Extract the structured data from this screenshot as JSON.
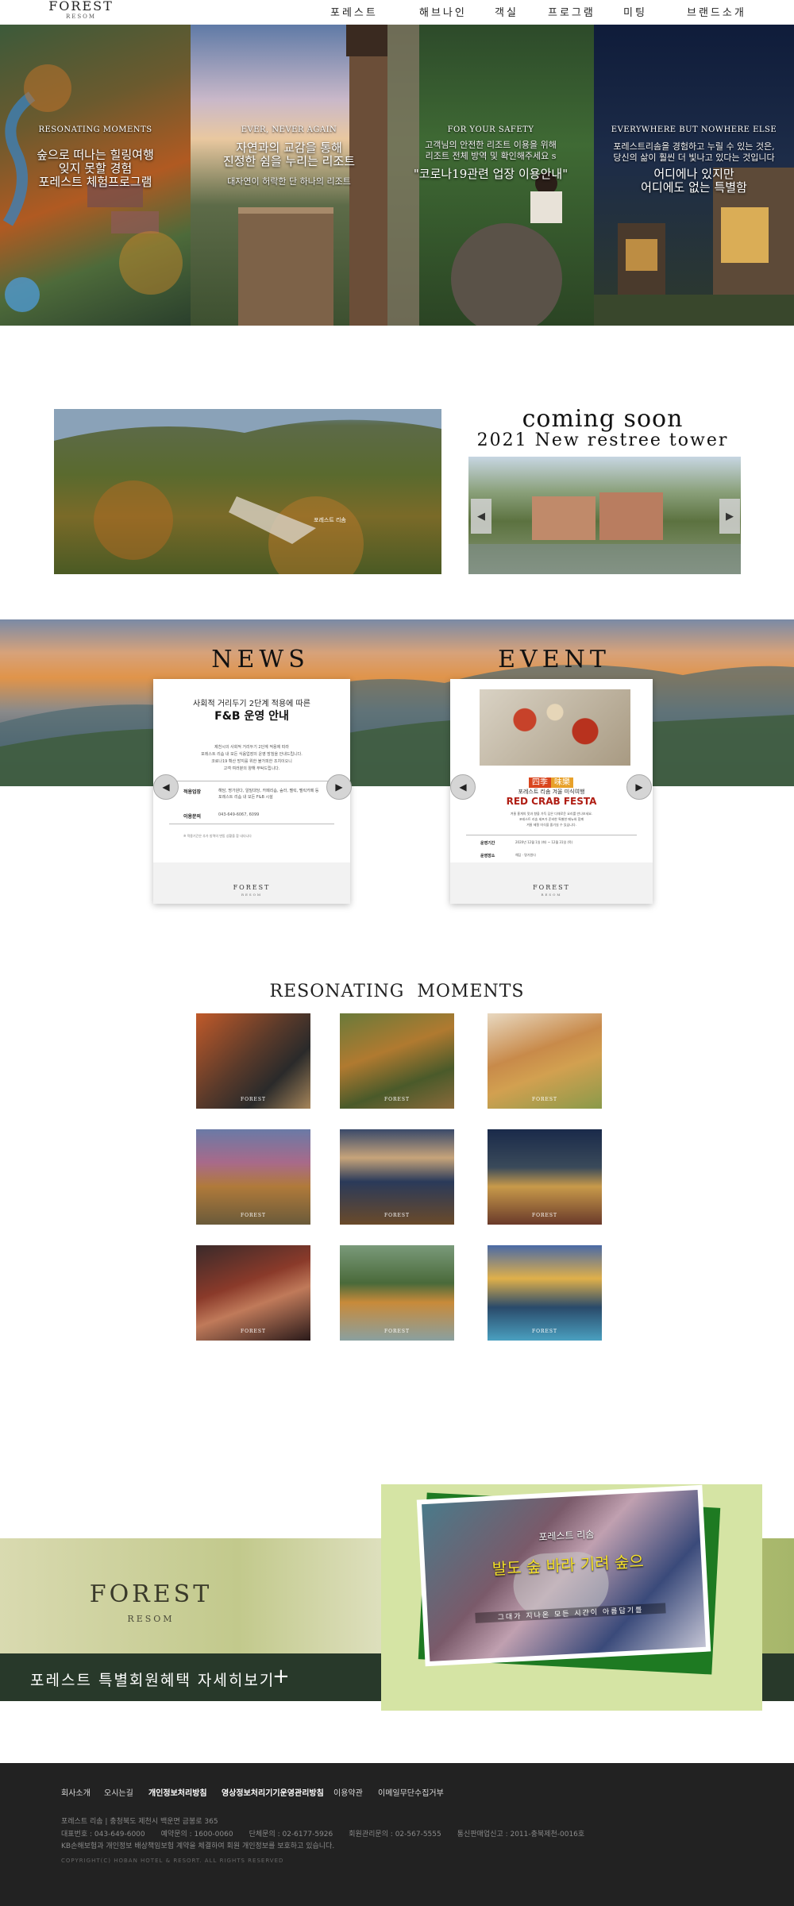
{
  "header": {
    "logo": "FOREST",
    "logo_sub": "RESOM",
    "nav": [
      "포레스트",
      "해브나인",
      "객실",
      "프로그램",
      "미팅",
      "브랜드소개"
    ]
  },
  "hero": [
    {
      "eyebrow": "RESONATING MOMENTS",
      "title": "숲으로 떠나는 힐링여행\n잊지 못할 경험\n포레스트 체험프로그램",
      "sub": ""
    },
    {
      "eyebrow": "EVER, NEVER AGAIN",
      "title": "자연과의 교감을 통해\n진정한 쉼을 누리는 리조트",
      "sub": "대자연이 허락한 단 하나의 리조트"
    },
    {
      "eyebrow": "FOR YOUR SAFETY",
      "title": "\"코로나19관련 업장 이용안내\"",
      "sub": "고객님의 안전한 리조트 이용을 위해\n리조트 전체 방역 및 확인해주세요 s"
    },
    {
      "eyebrow": "EVERYWHERE BUT NOWHERE ELSE",
      "title": "어디에나 있지만\n어디에도 없는 특별함",
      "sub": "포레스트리솜을 경험하고 누릴 수 있는 것은,\n당신의 삶이 훨씬 더 빛나고 있다는 것입니다"
    }
  ],
  "promo": {
    "aerial_caption": "포레스트 리솜",
    "coming_soon": "coming soon",
    "tower_title": "2021 New restree tower",
    "prev_icon": "◀",
    "next_icon": "▶"
  },
  "news": {
    "title": "NEWS",
    "card_heading": "사회적 거리두기 2단계 적용에 따른",
    "card_title": "F&B 운영 안내",
    "card_body": "제천시의 사회적 거리두기 2단계 적용에 따라\n포레스트 리솜 내 모든 식음업장의 운영 방침을 안내드립니다.\n코로나19 확산 방지를 위한 불가피한 조치이오니\n고객 여러분의 양해 부탁드립니다.",
    "row1_label": "적용업장",
    "row1_value": "해담, 명가원다, 알밀대당, 카페리솜, 숲라, 펠릭, 펠릭카페 등\n포레스트 리솜 내 모든 F&B 시설",
    "row2_label": "이용문의",
    "row2_value": "043-649-6067, 6099",
    "note": "※ 적용기간은 추가 방역의 변동 상황을 참 내다니다",
    "logo": "FOREST",
    "logo_sub": "RESOM"
  },
  "event": {
    "title": "EVENT",
    "badge_left": "四季",
    "badge_right": "味樂",
    "subtitle": "포레스트 리솜 겨울 미식여행",
    "card_title": "RED CRAB FESTA",
    "card_body": "겨울 홍게의 맛과 향을 가득 담은 다채로운 요리를 만나보세요.\n포레스트 리솜 셰프가 준비한 특별한 메뉴와 함께\n겨울 제철 미식을 즐기실 수 있습니다.",
    "row1_label": "운영기간",
    "row1_value": "2020년 12월 1일 (화) ~ 12월 31일 (목)",
    "row2_label": "운영장소",
    "row2_value": "해담 · 명가원다",
    "logo": "FOREST",
    "logo_sub": "RESOM"
  },
  "moments": {
    "title": "RESONATING  MOMENTS",
    "thumb_label": "FOREST",
    "items": [
      "moment-1",
      "moment-2",
      "moment-3",
      "moment-4",
      "moment-5",
      "moment-6",
      "moment-7",
      "moment-8",
      "moment-9"
    ]
  },
  "member": {
    "logo": "FOREST",
    "logo_sub": "RESOM",
    "cta": "포레스트 특별회원혜택 자세히보기",
    "cta_icon": "+",
    "photo_title": "포레스트 리솜",
    "photo_big": "발도 숲 바라 기려 숲으",
    "photo_grid": "그대가 지나온 모든 시간이 아름답기를"
  },
  "footer": {
    "links": [
      "회사소개",
      "오시는길",
      "개인정보처리방침",
      "영상정보처리기기운영관리방침",
      "이용약관",
      "이메일무단수집거부"
    ],
    "line1": "포레스트 리솜  |  충청북도 제천시 백운면 금봉로 365",
    "line2": "대표번호 : 043-649-6000       예약문의 : 1600-0060       단체문의 : 02-6177-5926       회원관리문의 : 02-567-5555       통신판매업신고 : 2011-충북제천-0016호",
    "line3": "KB손해보험과 개인정보 배상책임보험 계약을 체결하여 회원 개인정보를 보호하고 있습니다.",
    "copyright": "COPYRIGHT(C) HOBAN HOTEL & RESORT. ALL RIGHTS RESERVED"
  }
}
